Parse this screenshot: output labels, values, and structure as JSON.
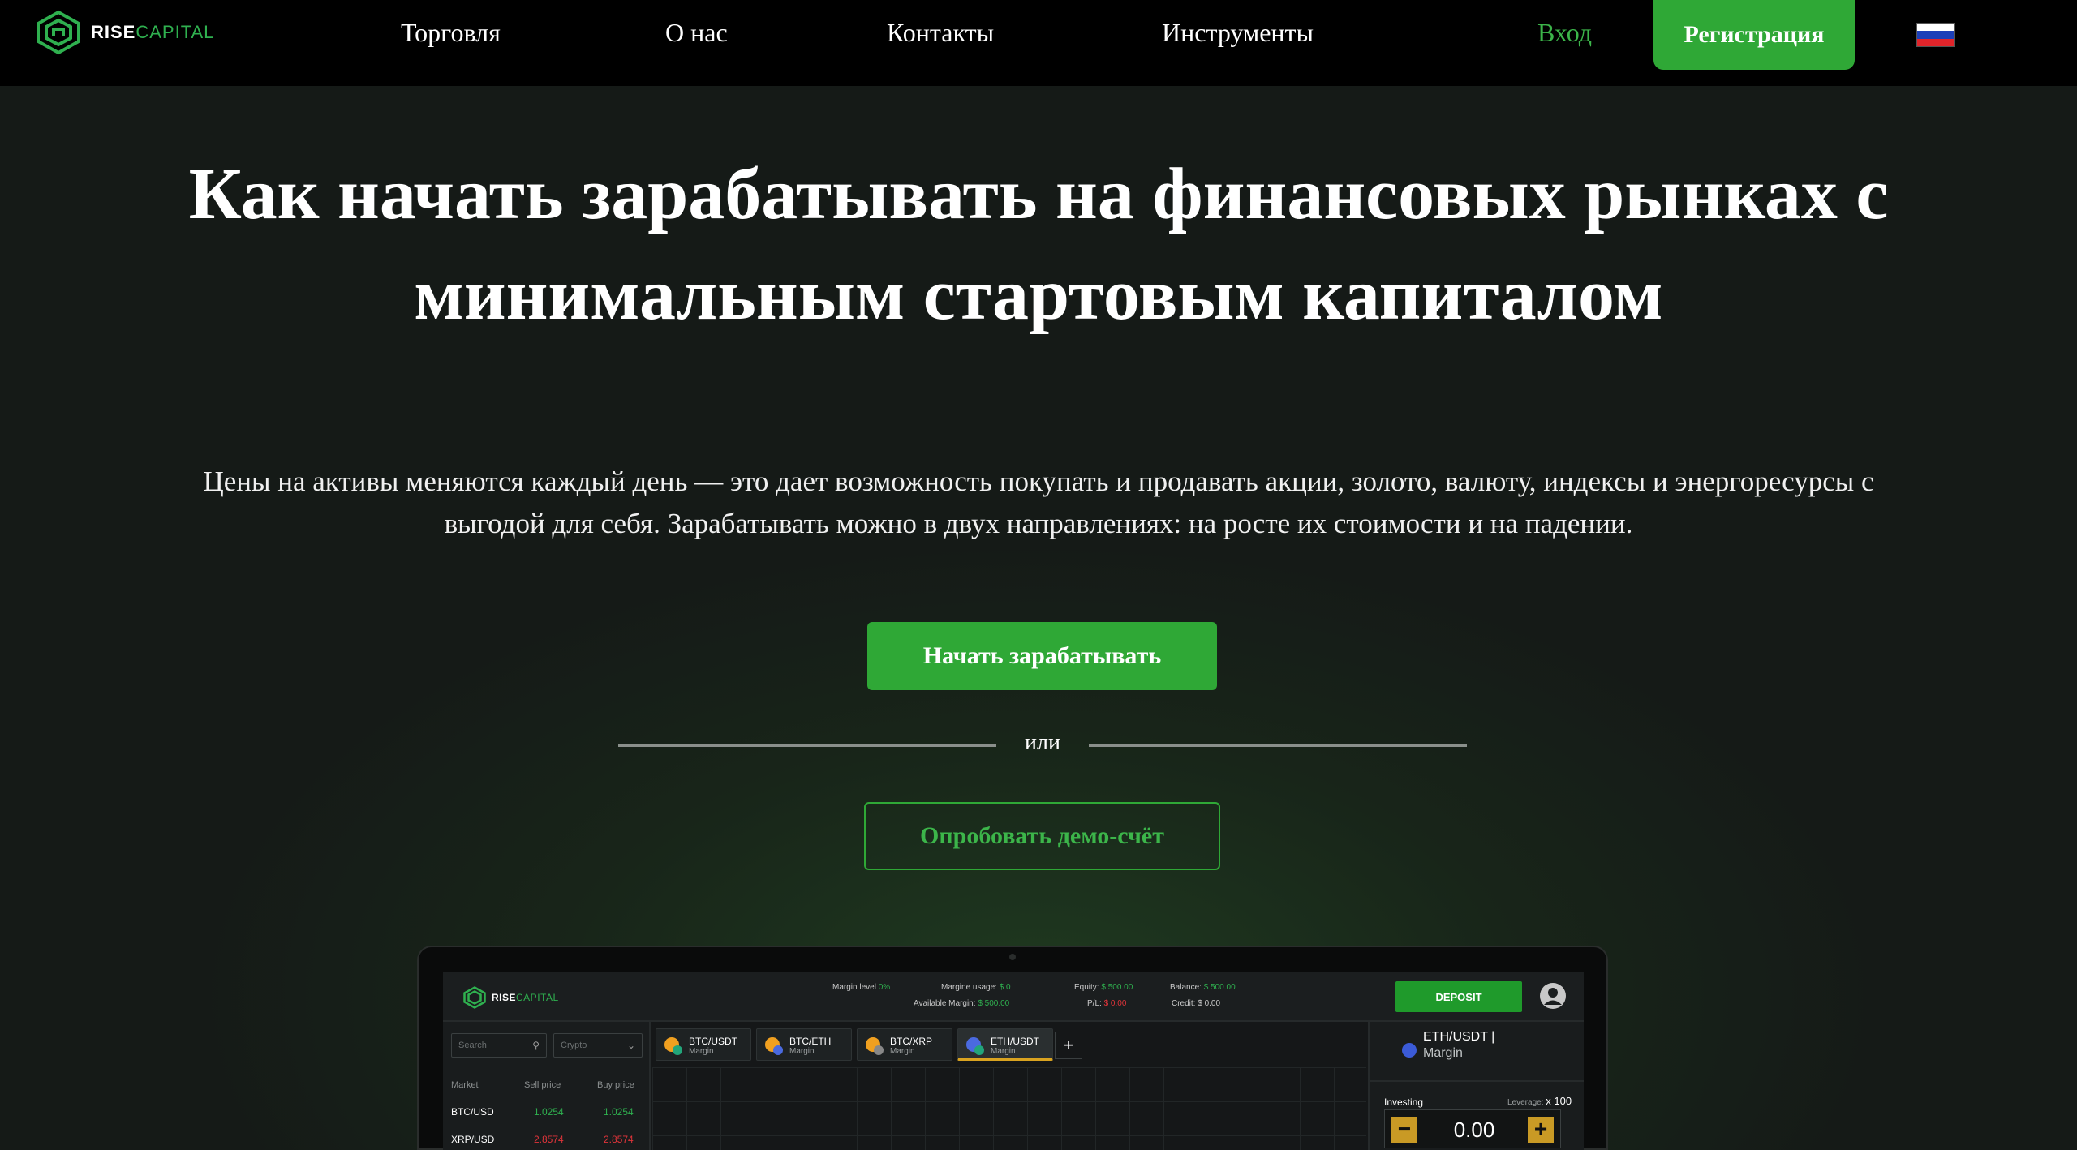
{
  "header": {
    "logo": {
      "part1": "RISE",
      "part2": "CAPITAL"
    },
    "nav": [
      "Торговля",
      "О нас",
      "Контакты",
      "Инструменты"
    ],
    "login_label": "Вход",
    "register_label": "Регистрация",
    "language_flag": "ru-flag-icon"
  },
  "hero": {
    "title_line1": "Как начать зарабатывать на финансовых рынках с",
    "title_line2": "минимальным стартовым капиталом",
    "subtitle_line1": "Цены на активы меняются каждый день — это дает возможность покупать и продавать акции, золото, валюту, индексы и энергоресурсы с",
    "subtitle_line2": "выгодой для себя. Зарабатывать можно в двух направлениях: на росте их стоимости и на падении.",
    "cta_label": "Начать зарабатывать",
    "or_label": "или",
    "demo_label": "Опробовать демо-счёт"
  },
  "mockup": {
    "logo": {
      "part1": "RISE",
      "part2": "CAPITAL"
    },
    "stats": {
      "margin_level_label": "Margin level",
      "margin_level_value": "0%",
      "margin_usage_label": "Margine usage:",
      "margin_usage_value": "$ 0",
      "available_margin_label": "Available Margin:",
      "available_margin_value": "$ 500.00",
      "equity_label": "Equity:",
      "equity_value": "$ 500.00",
      "pl_label": "P/L:",
      "pl_value": "$ 0.00",
      "balance_label": "Balance:",
      "balance_value": "$ 500.00",
      "credit_label": "Credit:",
      "credit_value": "$ 0.00"
    },
    "deposit_label": "DEPOSIT",
    "search_placeholder": "Search",
    "filter_value": "Crypto",
    "columns": [
      "Market",
      "Sell price",
      "Buy price"
    ],
    "rows": [
      {
        "market": "BTC/USD",
        "sell": "1.0254",
        "buy": "1.0254"
      },
      {
        "market": "XRP/USD",
        "sell": "2.8574",
        "buy": "2.8574"
      }
    ],
    "tabs": [
      {
        "pair": "BTC/USDT",
        "type": "Margin"
      },
      {
        "pair": "BTC/ETH",
        "type": "Margin"
      },
      {
        "pair": "BTC/XRP",
        "type": "Margin"
      },
      {
        "pair": "ETH/USDT",
        "type": "Margin"
      }
    ],
    "add_tab_label": "+",
    "right": {
      "pair": "ETH/USDT |",
      "type": "Margin",
      "investing_label": "Investing",
      "leverage_label": "Leverage",
      "leverage_value": "x 100",
      "amount": "0.00",
      "minus": "−",
      "plus": "+"
    }
  },
  "colors": {
    "accent_green": "#2fa836",
    "background": "#151a17",
    "header_bg": "#000000"
  }
}
